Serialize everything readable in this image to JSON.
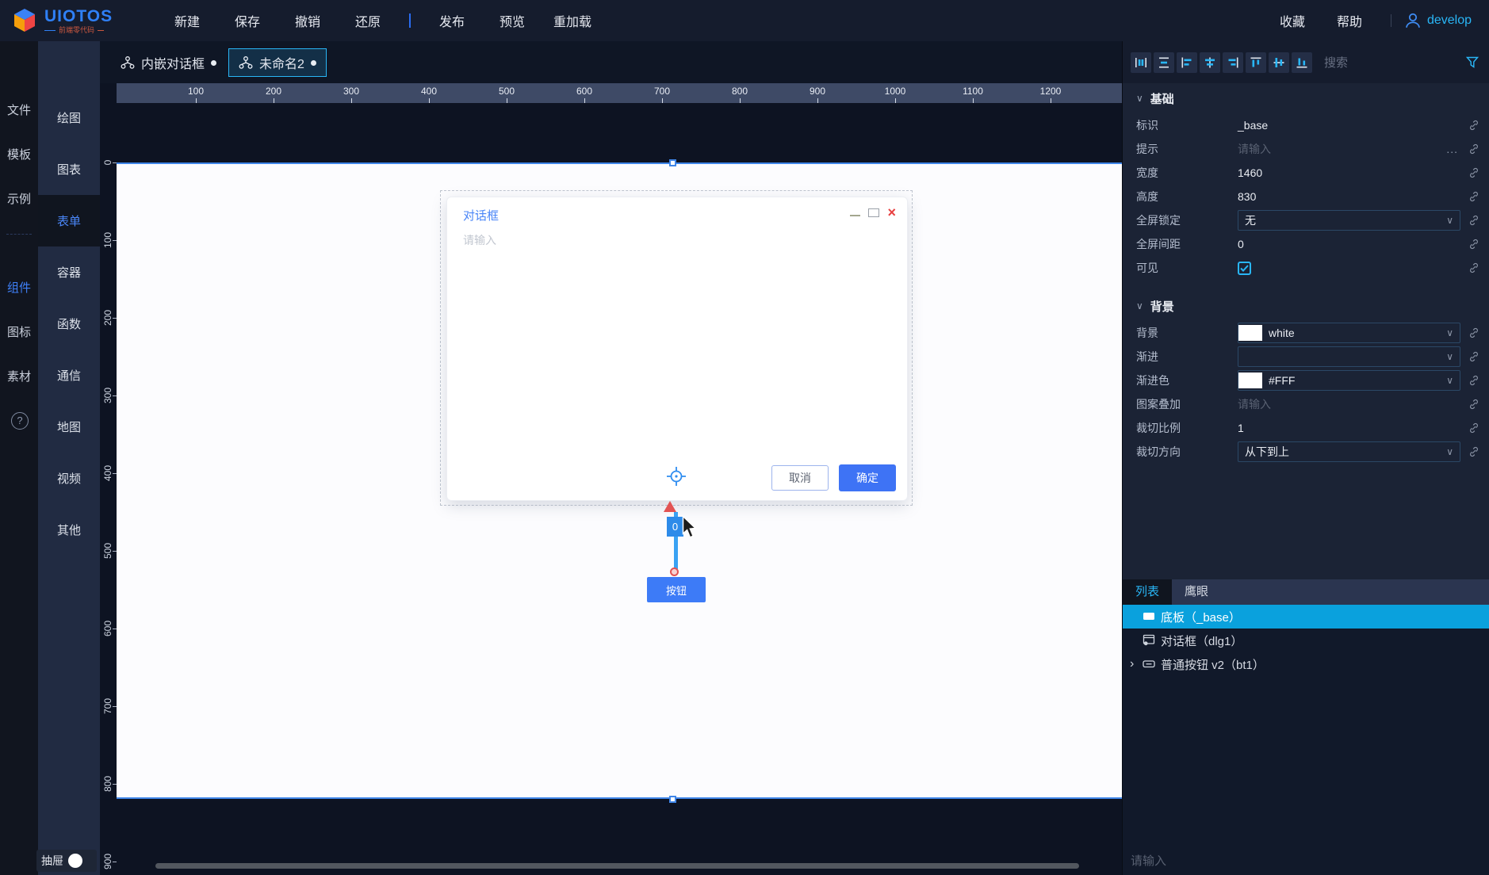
{
  "app": {
    "name": "UIOTOS",
    "subtitle": "前端零代码",
    "menus": [
      "新建",
      "保存",
      "撤销",
      "还原",
      "发布",
      "预览",
      "重加载"
    ],
    "right_menus": [
      "收藏",
      "帮助"
    ],
    "user": "develop"
  },
  "left_rail": {
    "items": [
      "文件",
      "模板",
      "示例",
      "组件",
      "图标",
      "素材"
    ],
    "active_item": "组件",
    "help": "?"
  },
  "component_rail": {
    "items": [
      "绘图",
      "图表",
      "表单",
      "容器",
      "函数",
      "通信",
      "地图",
      "视频",
      "其他"
    ],
    "active_item": "表单"
  },
  "tabs": [
    {
      "label": "内嵌对话框"
    },
    {
      "label": "未命名2"
    }
  ],
  "ruler": {
    "h": [
      "100",
      "200",
      "300",
      "400",
      "500",
      "600",
      "700",
      "800",
      "900",
      "1000",
      "1100",
      "1200"
    ],
    "v": [
      "0",
      "100",
      "200",
      "300",
      "400",
      "500",
      "600",
      "700",
      "800",
      "900"
    ]
  },
  "canvas": {
    "dialog": {
      "title": "对话框",
      "placeholder": "请输入",
      "cancel": "取消",
      "ok": "确定"
    },
    "button_label": "按钮",
    "connector_label": "0"
  },
  "inspector": {
    "search_placeholder": "搜索",
    "sections": {
      "basic": "基础",
      "background": "背景"
    },
    "rows": {
      "id": {
        "label": "标识",
        "value": "_base"
      },
      "tip": {
        "label": "提示",
        "placeholder": "请输入",
        "more": "..."
      },
      "width": {
        "label": "宽度",
        "value": "1460"
      },
      "height": {
        "label": "高度",
        "value": "830"
      },
      "fullscreen_lock": {
        "label": "全屏锁定",
        "value": "无"
      },
      "fullscreen_gap": {
        "label": "全屏间距",
        "value": "0"
      },
      "visible": {
        "label": "可见"
      },
      "bg": {
        "label": "背景",
        "value": "white",
        "swatch": "#ffffff"
      },
      "gradient": {
        "label": "渐进",
        "value": ""
      },
      "gradient_color": {
        "label": "渐进色",
        "value": "#FFF",
        "swatch": "#ffffff"
      },
      "pattern": {
        "label": "图案叠加",
        "placeholder": "请输入"
      },
      "clip_ratio": {
        "label": "裁切比例",
        "value": "1"
      },
      "clip_dir": {
        "label": "裁切方向",
        "value": "从下到上"
      }
    }
  },
  "layers": {
    "tabs": [
      "列表",
      "鹰眼"
    ],
    "items": [
      {
        "label": "底板（_base）"
      },
      {
        "label": "对话框（dlg1）"
      },
      {
        "label": "普通按钮 v2（bt1）"
      }
    ],
    "bottom_placeholder": "请输入"
  },
  "drawer": {
    "label": "抽屉"
  },
  "colors": {
    "accent": "#29b6f6",
    "primary": "#3e79f6",
    "selected_row": "#0aa1dd",
    "canvas_bg": "#ffffff"
  }
}
